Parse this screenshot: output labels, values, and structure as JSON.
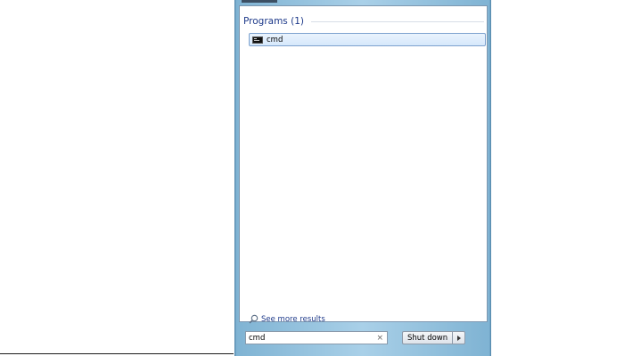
{
  "results": {
    "section_title": "Programs (1)",
    "items": [
      {
        "label": "cmd",
        "icon": "command-prompt-icon"
      }
    ]
  },
  "see_more_label": "See more results",
  "search": {
    "value": "cmd",
    "clear_glyph": "×"
  },
  "shutdown": {
    "label": "Shut down"
  },
  "colors": {
    "accent_text": "#1e3a8a",
    "frame": "#7fb3d3",
    "selected_item": "#d6e8fb"
  }
}
